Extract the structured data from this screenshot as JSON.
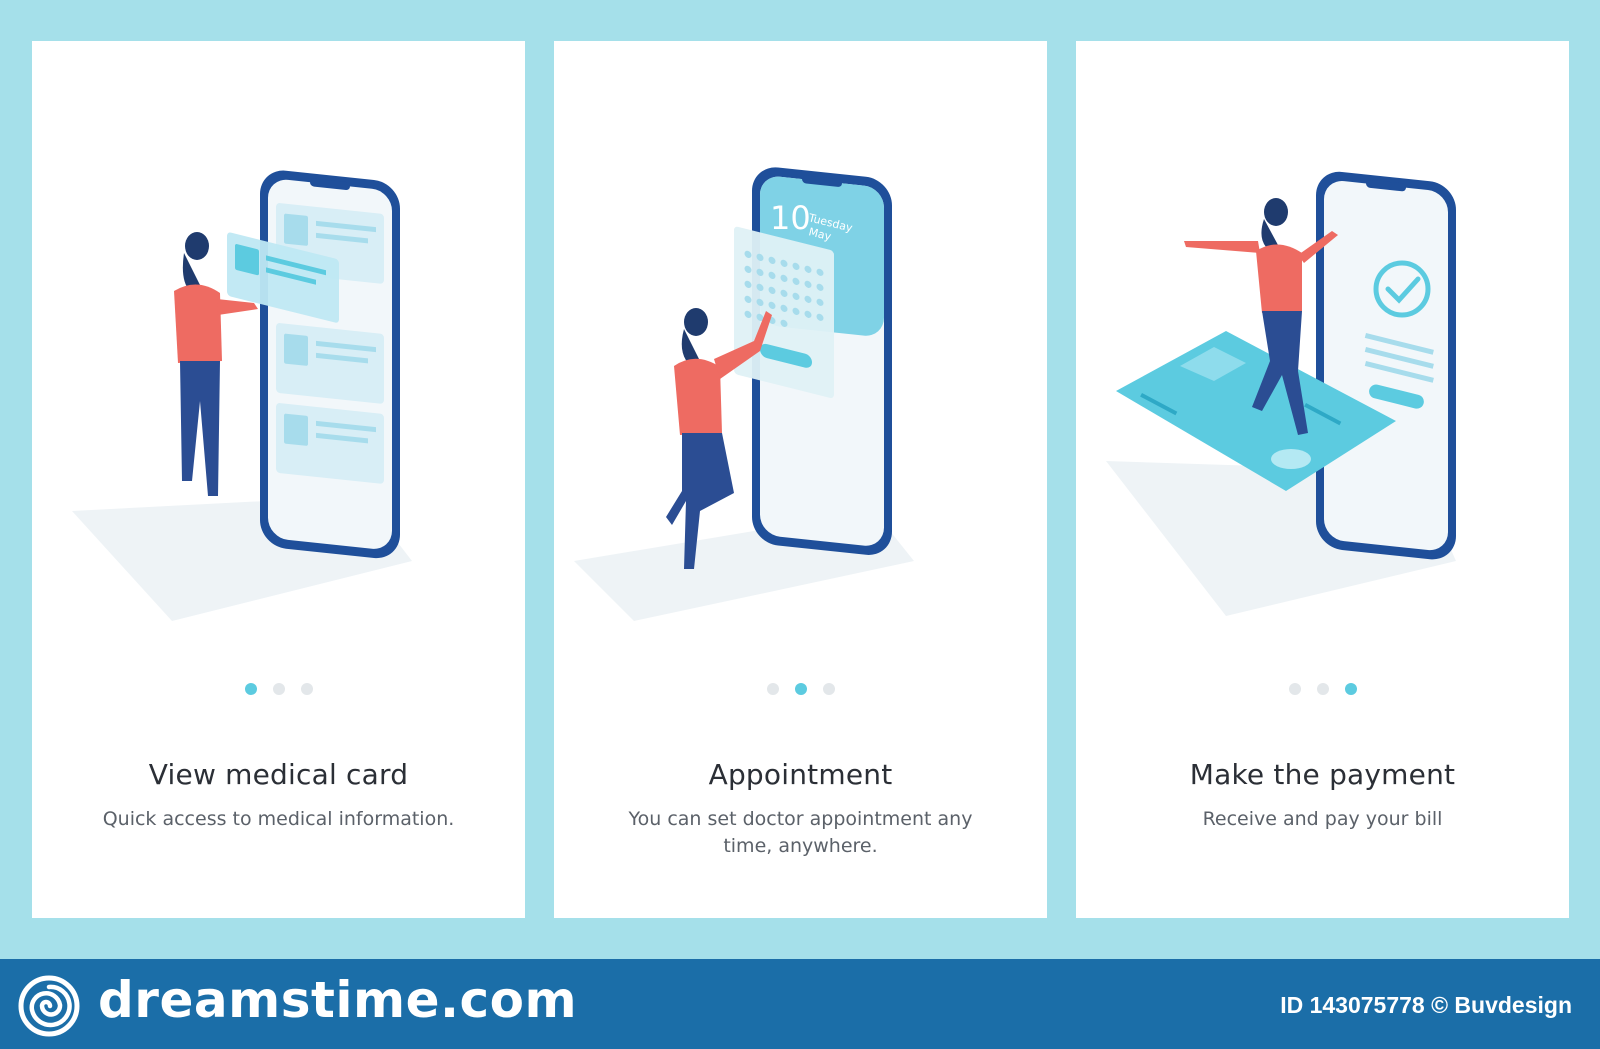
{
  "colors": {
    "frame": "#a5e0ea",
    "footer": "#1b6ea8",
    "phone_outline": "#1f4f9a",
    "accent": "#5ccbe0",
    "person_shirt": "#ee6b62",
    "person_pants": "#2b4d93"
  },
  "slides": [
    {
      "title": "View medical card",
      "description": "Quick access to medical information.",
      "active_dot": 1,
      "illustration": "medical-card-phone"
    },
    {
      "title": "Appointment",
      "description": "You can set doctor appointment any time, anywhere.",
      "active_dot": 2,
      "illustration": "calendar-phone",
      "calendar": {
        "day": "10",
        "weekday": "Tuesday",
        "month": "May"
      }
    },
    {
      "title": "Make the payment",
      "description": "Receive and pay your bill",
      "active_dot": 3,
      "illustration": "payment-card-phone"
    }
  ],
  "footer": {
    "brand": "dreamstime.com",
    "logo_icon": "spiral-icon",
    "credit": "ID 143075778 © Buvdesign"
  }
}
